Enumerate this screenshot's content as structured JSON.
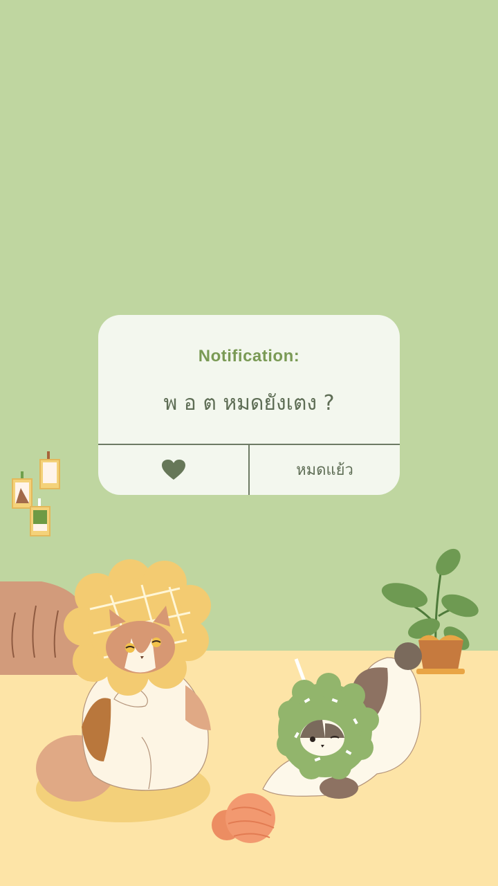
{
  "notification": {
    "title": "Notification:",
    "message": "พ อ ต หมดยังเตง ?",
    "heart_icon": "heart-icon",
    "done_label": "หมดแย้ว"
  },
  "colors": {
    "wall": "#bfd6a0",
    "floor": "#fde4a7",
    "card": "#f3f7ee",
    "title": "#7a9a55",
    "text": "#5e6d55"
  }
}
